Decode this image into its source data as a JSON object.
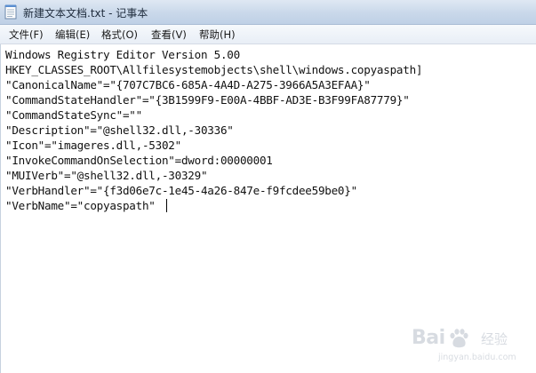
{
  "window": {
    "title": "新建文本文档.txt - 记事本",
    "icon": "notepad-icon"
  },
  "menu": {
    "items": [
      {
        "label": "文件(F)"
      },
      {
        "label": "编辑(E)"
      },
      {
        "label": "格式(O)"
      },
      {
        "label": "查看(V)"
      },
      {
        "label": "帮助(H)"
      }
    ]
  },
  "document": {
    "lines": [
      "Windows Registry Editor Version 5.00",
      "HKEY_CLASSES_ROOT\\Allfilesystemobjects\\shell\\windows.copyaspath]",
      "\"CanonicalName\"=\"{707C7BC6-685A-4A4D-A275-3966A5A3EFAA}\"",
      "\"CommandStateHandler\"=\"{3B1599F9-E00A-4BBF-AD3E-B3F99FA87779}\"",
      "\"CommandStateSync\"=\"\"",
      "\"Description\"=\"@shell32.dll,-30336\"",
      "\"Icon\"=\"imageres.dll,-5302\"",
      "\"InvokeCommandOnSelection\"=dword:00000001",
      "\"MUIVerb\"=\"@shell32.dll,-30329\"",
      "\"VerbHandler\"=\"{f3d06e7c-1e45-4a26-847e-f9fcdee59be0}\"",
      "\"VerbName\"=\"copyaspath\""
    ]
  },
  "watermark": {
    "brand": "Bai",
    "brand2": "经验",
    "url": "jingyan.baidu.com",
    "icon": "baidu-paw-icon"
  }
}
